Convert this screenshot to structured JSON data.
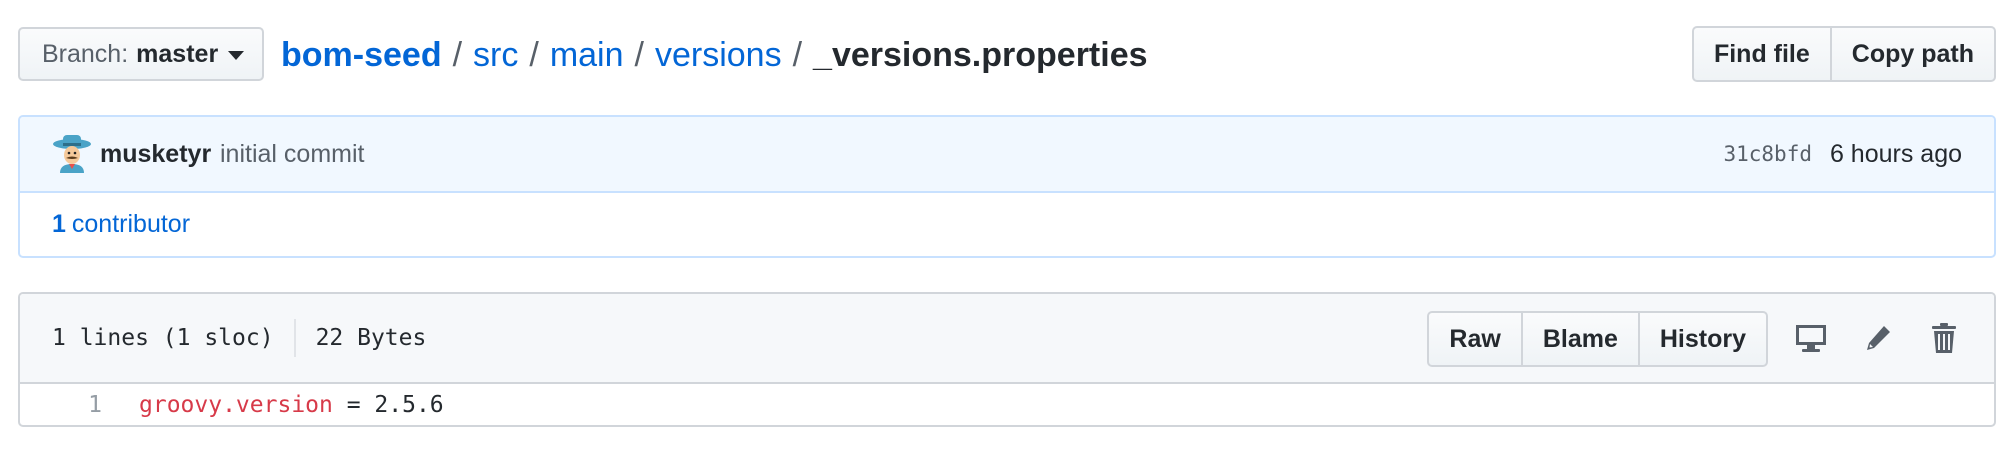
{
  "branch": {
    "label": "Branch:",
    "value": "master"
  },
  "breadcrumb": {
    "repo": "bom-seed",
    "separator": "/",
    "path": [
      "src",
      "main",
      "versions"
    ],
    "file": "_versions.properties"
  },
  "file_nav": {
    "find_file": "Find file",
    "copy_path": "Copy path"
  },
  "commit": {
    "author": "musketyr",
    "message": "initial commit",
    "sha": "31c8bfd",
    "time": "6 hours ago",
    "avatar_icon": "cowboy-avatar"
  },
  "contributors": {
    "count": "1",
    "label": "contributor"
  },
  "file": {
    "lines": "1 lines (1 sloc)",
    "size": "22 Bytes",
    "actions": {
      "raw": "Raw",
      "blame": "Blame",
      "history": "History"
    },
    "icons": [
      "desktop-icon",
      "pencil-icon",
      "trash-icon"
    ]
  },
  "code": [
    {
      "line": "1",
      "key": "groovy.version",
      "op": " = ",
      "value": "2.5.6"
    }
  ],
  "colors": {
    "link": "#0366d6",
    "commit_bg": "#f1f8ff",
    "commit_border": "#c8e1ff",
    "code_key": "#d73a49"
  }
}
